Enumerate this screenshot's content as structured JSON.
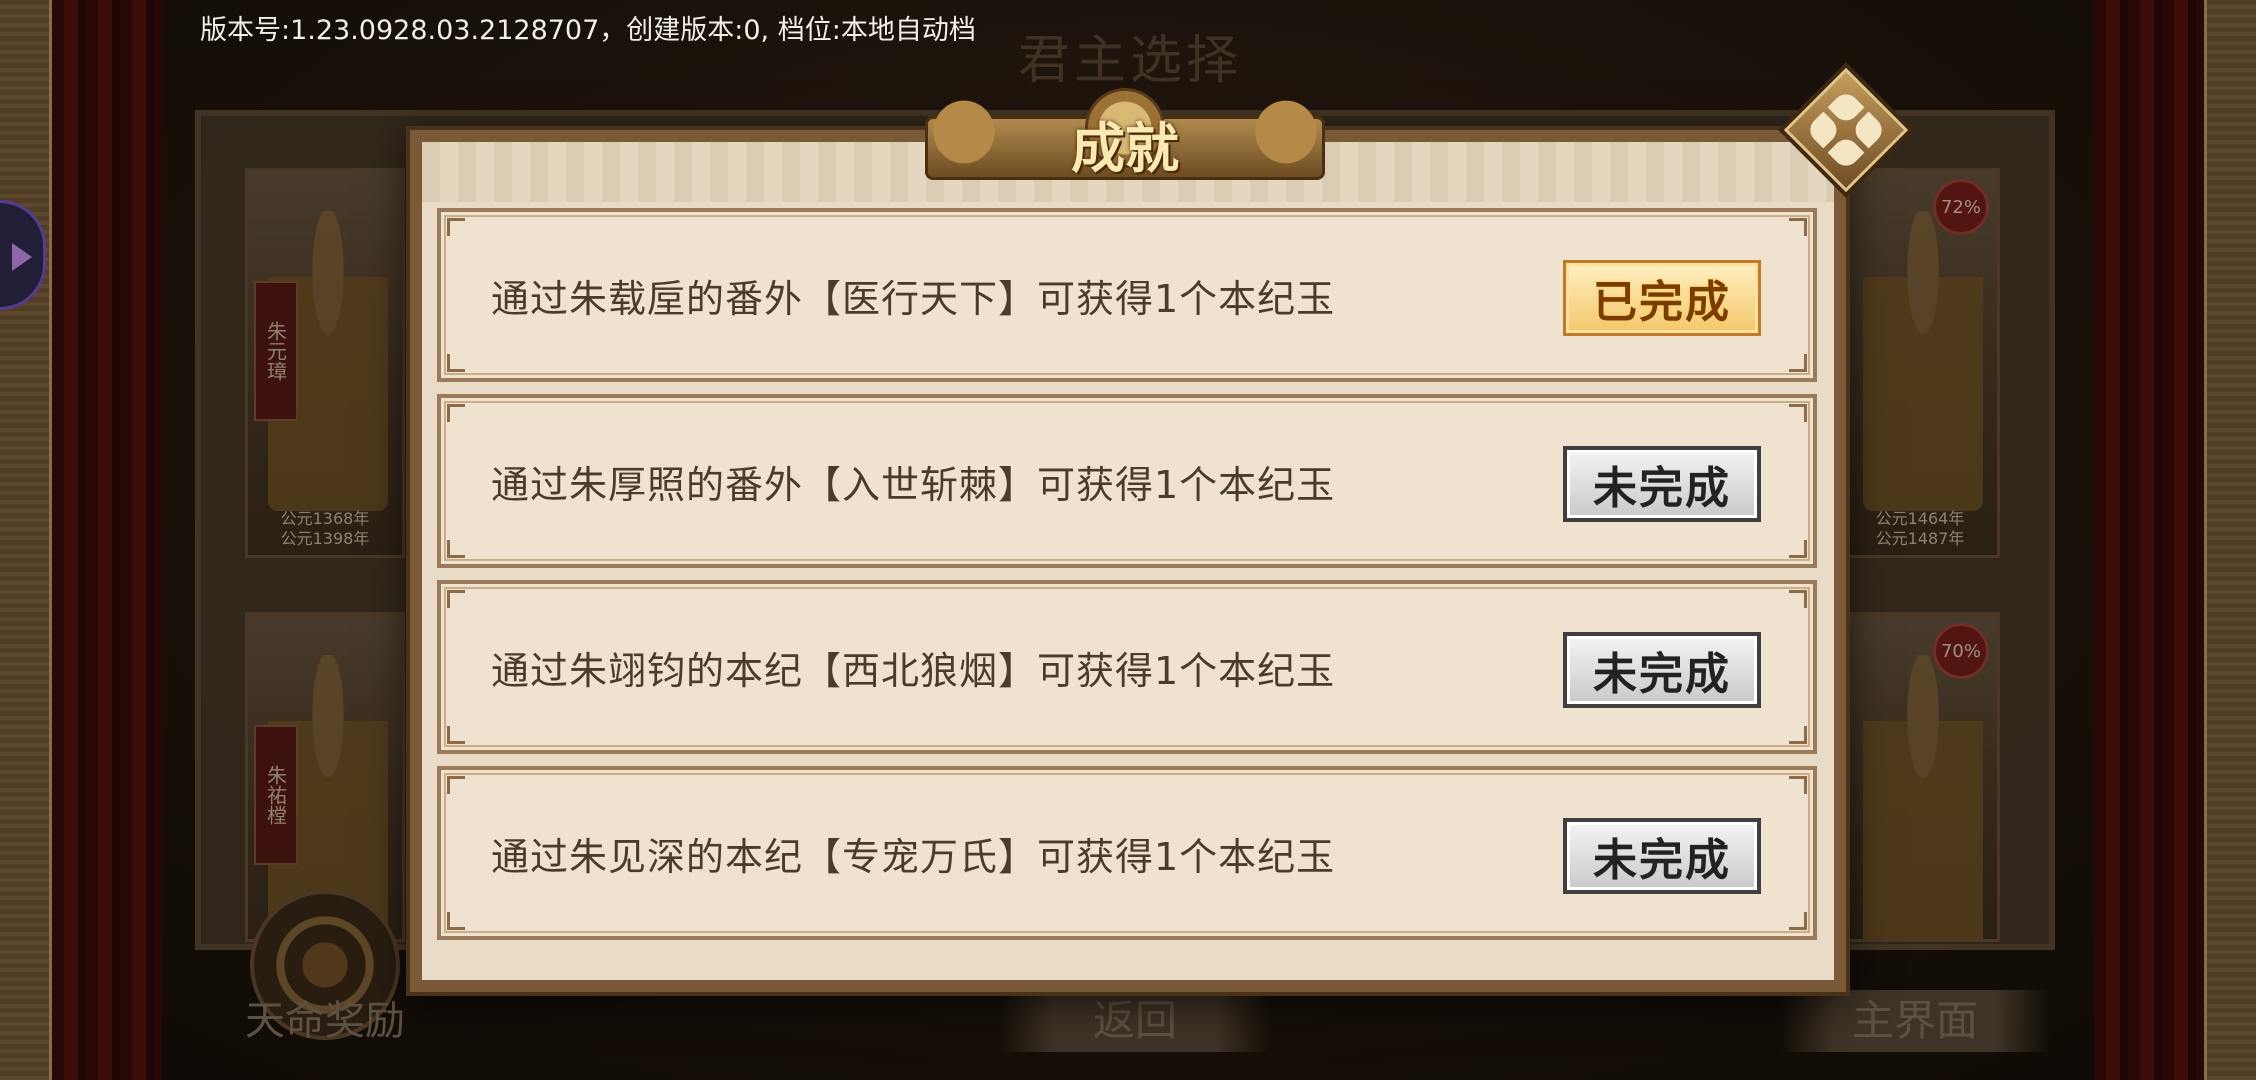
{
  "version_info": "版本号:1.23.0928.03.2128707，创建版本:0, 档位:本地自动档",
  "background": {
    "title": "君主选择",
    "characters": [
      {
        "name": "朱元璋",
        "years": [
          "公元1368年",
          "公元1398年"
        ],
        "percent": ""
      },
      {
        "name": "",
        "years": [
          "公元1464年",
          "公元1487年"
        ],
        "percent": "72%"
      },
      {
        "name": "朱祐樘",
        "years": [],
        "percent": ""
      },
      {
        "name": "",
        "years": [],
        "percent": "70%"
      }
    ],
    "return_label": "返回",
    "main_label": "主界面",
    "reward_label": "天命奖励"
  },
  "modal": {
    "title": "成就",
    "achievements": [
      {
        "text": "通过朱载垕的番外【医行天下】可获得1个本纪玉",
        "status": "已完成",
        "completed": true
      },
      {
        "text": "通过朱厚照的番外【入世斩棘】可获得1个本纪玉",
        "status": "未完成",
        "completed": false
      },
      {
        "text": "通过朱翊钧的本纪【西北狼烟】可获得1个本纪玉",
        "status": "未完成",
        "completed": false
      },
      {
        "text": "通过朱见深的本纪【专宠万氏】可获得1个本纪玉",
        "status": "未完成",
        "completed": false
      }
    ]
  },
  "colors": {
    "modal_bg": "#e9dcc6",
    "frame": "#7a5a36",
    "done_accent": "#f3c76a",
    "todo_accent": "#c9c9c9"
  },
  "icons": {
    "close": "close-flower-icon",
    "side_tab": "chevron-right-icon",
    "reward": "reward-emblem-icon"
  }
}
